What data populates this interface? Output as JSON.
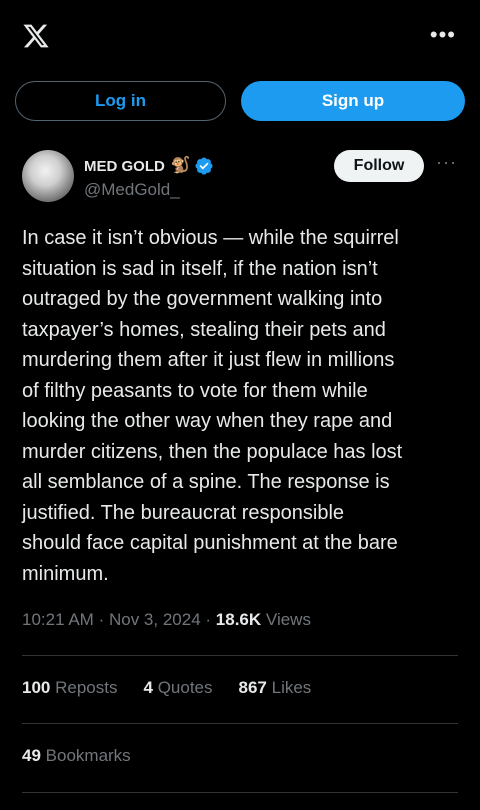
{
  "header": {
    "logo": "x-logo-icon",
    "more_icon": "more-horizontal-icon",
    "more_label": "•••"
  },
  "auth": {
    "login_label": "Log in",
    "signup_label": "Sign up"
  },
  "author": {
    "display_name": "MED GOLD",
    "emoji": "🐒",
    "verified_icon": "verified-badge-icon",
    "handle": "@MedGold_",
    "follow_label": "Follow"
  },
  "tweet": {
    "text": "In case it isn’t obvious — while the squirrel\nsituation is sad in itself, if the nation isn’t\noutraged by the government walking into\ntaxpayer’s homes, stealing their pets and\nmurdering them after it just flew in millions\nof filthy peasants to vote for them while\nlooking the other way when they rape and\nmurder citizens, then the populace has lost\nall semblance of a spine. The response is\njustified. The bureaucrat responsible\nshould face capital punishment at the bare\nminimum.",
    "time": "10:21 AM",
    "sep": "·",
    "date": "Nov 3, 2024",
    "views_count": "18.6K",
    "views_label": "Views",
    "more_label": "···"
  },
  "stats": {
    "reposts_count": "100",
    "reposts_label": "Reposts",
    "quotes_count": "4",
    "quotes_label": "Quotes",
    "likes_count": "867",
    "likes_label": "Likes",
    "bookmarks_count": "49",
    "bookmarks_label": "Bookmarks"
  },
  "colors": {
    "accent": "#1d9bf0",
    "background": "#000000",
    "muted": "#71767b"
  }
}
